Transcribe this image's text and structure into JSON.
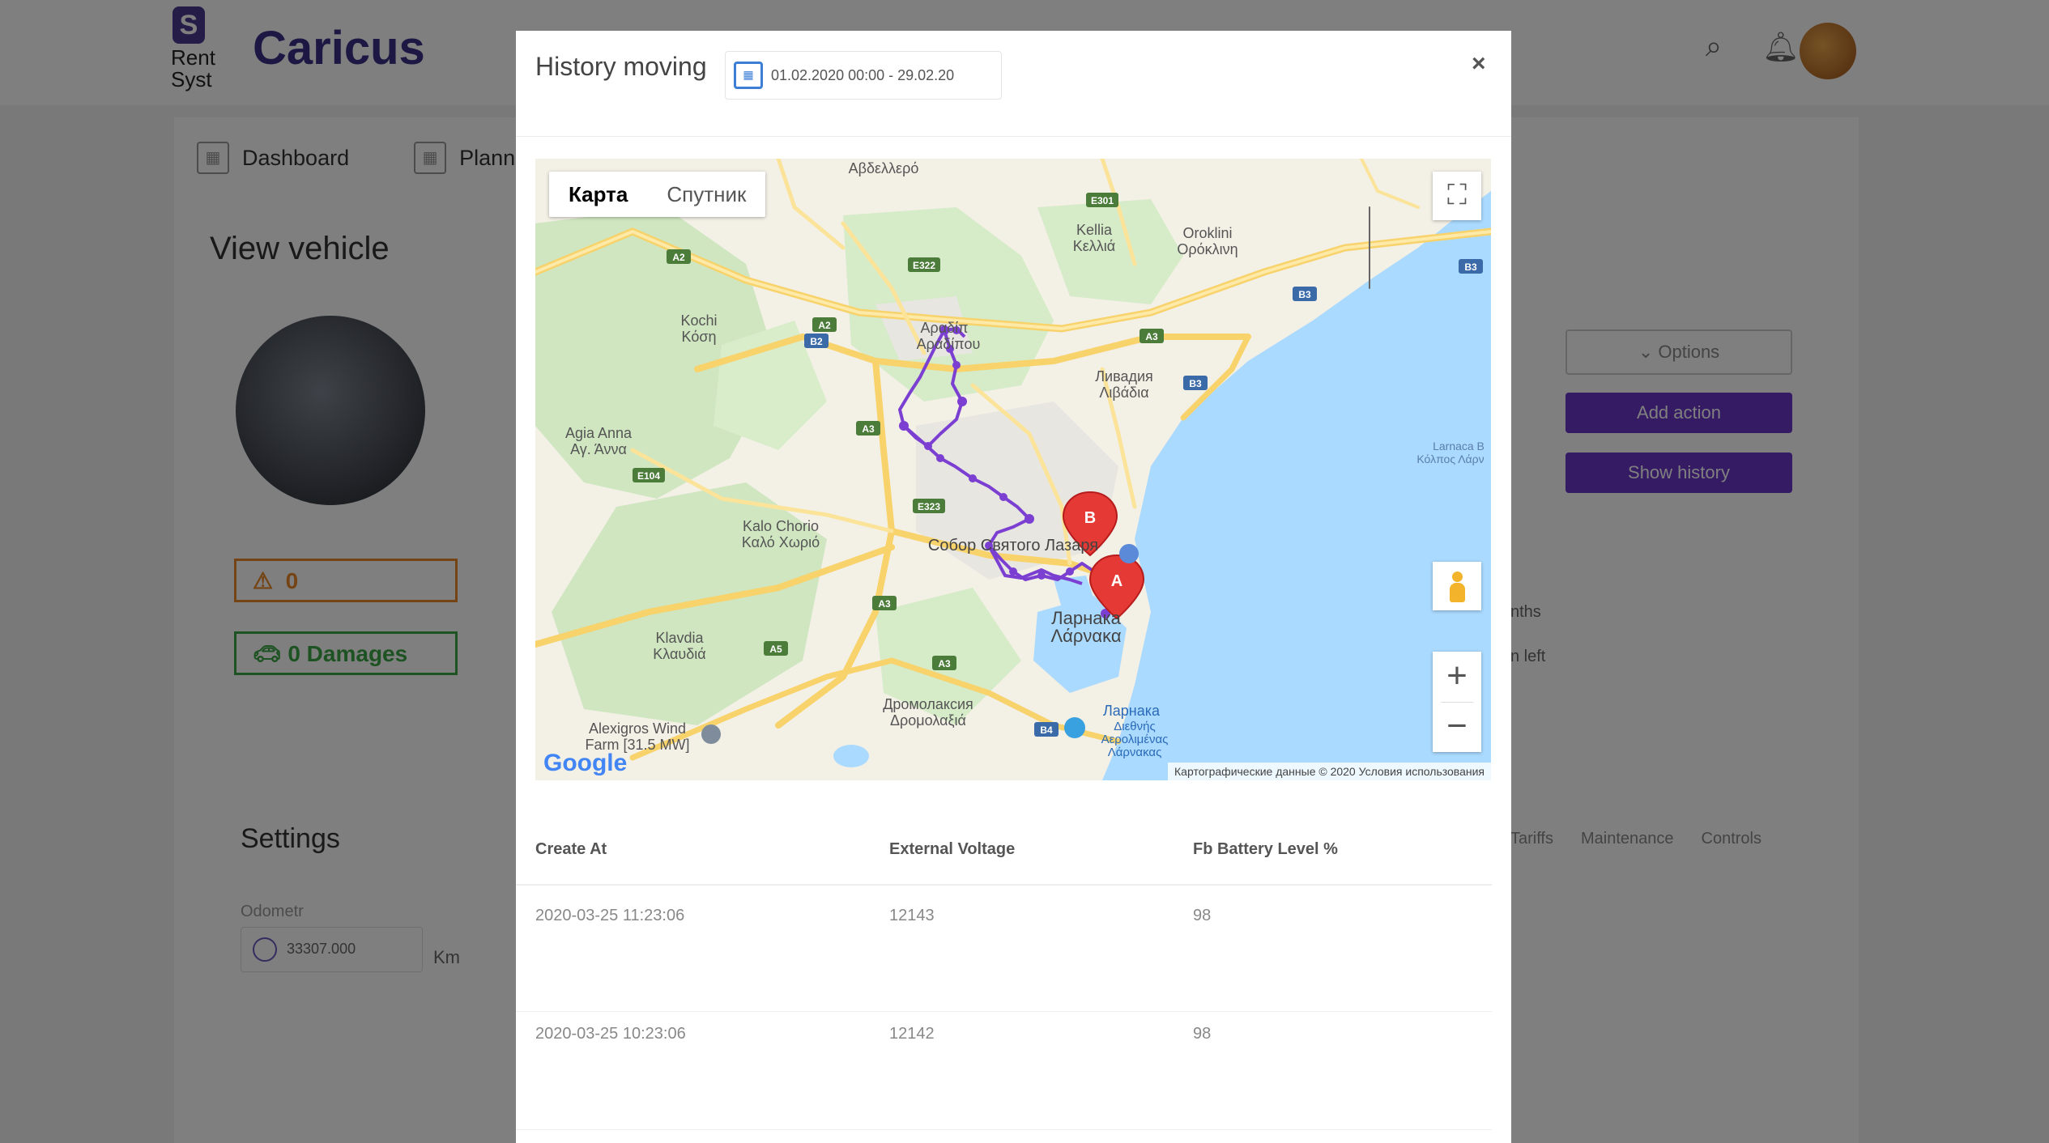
{
  "app": {
    "logo_text_1": "Rent",
    "logo_text_2": "Syst",
    "brand": "Caricus",
    "nav": [
      {
        "label": "Dashboard"
      },
      {
        "label": "Planni"
      }
    ],
    "page_title": "View vehicle",
    "warning_count": "0",
    "damages_label": "0  Damages",
    "options_label": "Options",
    "add_action_label": "Add action",
    "show_history_label": "Show history",
    "side_note_1": "nths",
    "side_note_2": "n left",
    "right_tabs": [
      "Tariffs",
      "Maintenance",
      "Controls"
    ],
    "settings_title": "Settings",
    "odometer_label": "Odometr",
    "odometer_value": "33307.000",
    "odometer_unit": "Km"
  },
  "modal": {
    "title": "History moving",
    "date_range": "01.02.2020 00:00 - 29.02.20",
    "close_label": "×",
    "map": {
      "type_buttons": [
        {
          "label": "Карта",
          "active": true
        },
        {
          "label": "Спутник",
          "active": false
        }
      ],
      "labels": {
        "avdellero": "Αβδελλερό",
        "oroklini_1": "Oroklini",
        "oroklini_2": "Ορόκλινη",
        "kellia_1": "Kellia",
        "kellia_2": "Κελλιά",
        "kochi_1": "Kochi",
        "kochi_2": "Κόση",
        "aradippou_1": "Αραδίπ",
        "aradippou_2": "Αραδίπου",
        "livadia_1": "Ливадия",
        "livadia_2": "Λιβάδια",
        "agia_anna_1": "Agia Anna",
        "agia_anna_2": "Αγ. Άννα",
        "kalo_chorio_1": "Kalo Chorio",
        "kalo_chorio_2": "Καλό Χωριό",
        "sobor": "Собор Святого Лазаря",
        "larnaka_1": "Ларнака",
        "larnaka_2": "Λάρνακα",
        "klavdia_1": "Klavdia",
        "klavdia_2": "Κλαυδιά",
        "dromolaxia_1": "Дромолаксия",
        "dromolaxia_2": "Δρομολαξιά",
        "airport_1": "Ларнака",
        "airport_2": "Διεθνής",
        "airport_3": "Αερολιμένας",
        "airport_4": "Λάρνακας",
        "alexigros_1": "Alexigros Wind",
        "alexigros_2": "Farm [31.5 MW]",
        "larnaca_bay_1": "Larnaca B",
        "larnaca_bay_2": "Κόλπος Λάρν"
      },
      "road_shields": [
        "E301",
        "E322",
        "A2",
        "A2",
        "B2",
        "A3",
        "B3",
        "B3",
        "A3",
        "E104",
        "E323",
        "A3",
        "A5",
        "A3",
        "B4",
        "B3"
      ],
      "markers": [
        {
          "label": "B",
          "color": "#e53935"
        },
        {
          "label": "A",
          "color": "#e53935"
        }
      ],
      "route_color": "#7b3fd1",
      "google_logo": "Google",
      "attribution": "Картографические данные © 2020   Условия использования"
    },
    "table": {
      "headers": [
        "Create At",
        "External Voltage",
        "Fb Battery Level %"
      ],
      "rows": [
        [
          "2020-03-25 11:23:06",
          "12143",
          "98"
        ],
        [
          "2020-03-25 10:23:06",
          "12142",
          "98"
        ]
      ]
    }
  }
}
